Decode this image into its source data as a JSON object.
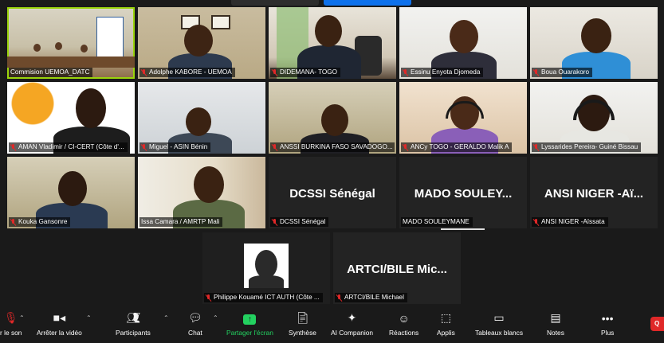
{
  "tiles": [
    {
      "name": "Commision UEMOA_DATC"
    },
    {
      "name": "Adolphe KABORE - UEMOA"
    },
    {
      "name": "DIDEMANA- TOGO"
    },
    {
      "name": "Essinu Enyota Djomeda"
    },
    {
      "name": "Boua Ouarakoro"
    },
    {
      "name": "AMAN Vladimir / CI-CERT (Côte d'..."
    },
    {
      "name": "Miguel - ASIN Bénin"
    },
    {
      "name": "ANSSI BURKINA FASO SAVADOGO..."
    },
    {
      "name": "ANCy TOGO - GERALDO Malik A"
    },
    {
      "name": "Lyssarides Pereira- Guiné Bissau"
    },
    {
      "name": "Kouka Gansonre"
    },
    {
      "name": "Issa Camara / AMRTP Mali"
    },
    {
      "name": "DCSSI Sénégal",
      "display": "DCSSI Sénégal"
    },
    {
      "name": "MADO SOULEYMANE",
      "display": "MADO SOULEY..."
    },
    {
      "name": "ANSI NIGER -Aïssata",
      "display": "ANSI NIGER -Aï..."
    },
    {
      "name": "Philippe Kouamé ICT AUTH (Côte ..."
    },
    {
      "name": "ARTCI/BILE Michael",
      "display": "ARTCI/BILE Mic..."
    }
  ],
  "toolbar": {
    "audio_label": "r le son",
    "video_label": "Arrêter la vidéo",
    "participants_label": "Participants",
    "participants_count": "17",
    "chat_label": "Chat",
    "share_label": "Partager l'écran",
    "summary_label": "Synthèse",
    "companion_label": "AI Companion",
    "reactions_label": "Réactions",
    "apps_label": "Applis",
    "whiteboards_label": "Tableaux blancs",
    "notes_label": "Notes",
    "more_label": "Plus",
    "quit_label": "Q"
  },
  "colors": {
    "active_speaker": "#9ad40c",
    "share_green": "#23d160",
    "muted": "#e02828"
  }
}
